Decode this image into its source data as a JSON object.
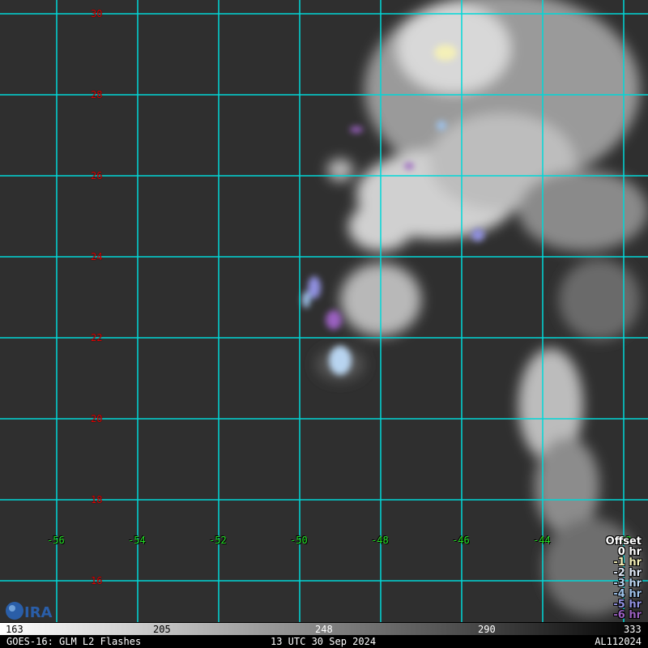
{
  "latitude_labels": [
    "30",
    "28",
    "26",
    "24",
    "22",
    "20",
    "18",
    "16"
  ],
  "longitude_labels": [
    "-56",
    "-54",
    "-52",
    "-50",
    "-48",
    "-46",
    "-44",
    "-42"
  ],
  "legend": {
    "title": "Offset",
    "entries": [
      {
        "label": "0 hr",
        "color": "#ffffff"
      },
      {
        "label": "-1 hr",
        "color": "#f4f0b8"
      },
      {
        "label": "-2 hr",
        "color": "#dde6f4"
      },
      {
        "label": "-3 hr",
        "color": "#b8d4f0"
      },
      {
        "label": "-4 hr",
        "color": "#9ec2ea"
      },
      {
        "label": "-5 hr",
        "color": "#9090e0"
      },
      {
        "label": "-6 hr",
        "color": "#9a60c0"
      }
    ]
  },
  "colorbar": {
    "ticks": [
      "163",
      "205",
      "248",
      "290",
      "333"
    ]
  },
  "footer": {
    "product": "GOES-16: GLM L2 Flashes",
    "time": "13 UTC 30 Sep 2024",
    "storm_id": "AL112024"
  },
  "logo_text": "CIRA",
  "colors": {
    "grid": "#00d8d8",
    "lat_label": "#e00000",
    "lon_label": "#22e022"
  }
}
